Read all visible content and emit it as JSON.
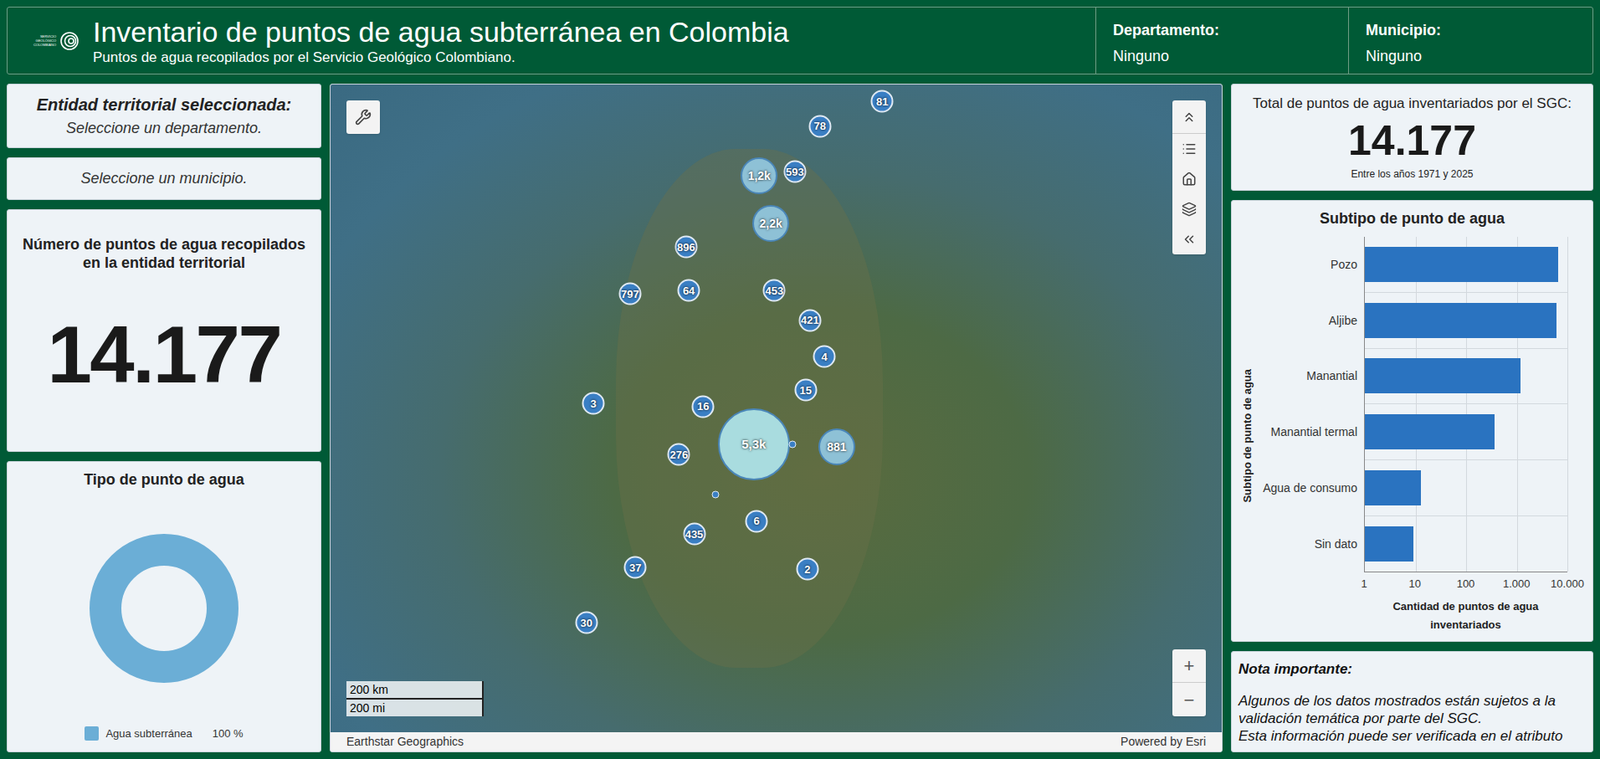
{
  "header": {
    "logo_text": "SERVICIO GEOLÓGICO COLOMBIANO",
    "title": "Inventario de puntos de agua subterránea en Colombia",
    "subtitle": "Puntos de agua recopilados por el Servicio Geológico Colombiano.",
    "filters": [
      {
        "label": "Departamento:",
        "value": "Ninguno"
      },
      {
        "label": "Municipio:",
        "value": "Ninguno"
      }
    ]
  },
  "left": {
    "entity_card": {
      "title": "Entidad territorial seleccionada:",
      "hint": "Seleccione un departamento."
    },
    "municipio_card": {
      "hint": "Seleccione un municipio."
    },
    "count_card": {
      "title": "Número de puntos de agua recopilados en la entidad territorial",
      "value": "14.177"
    },
    "type_card": {
      "title": "Tipo de punto de agua",
      "series": [
        {
          "label": "Agua subterránea",
          "percent_text": "100 %",
          "values": [
            100
          ],
          "color": "#6baed6"
        }
      ]
    }
  },
  "map": {
    "clusters": [
      {
        "label": "81",
        "kind": "small"
      },
      {
        "label": "78",
        "kind": "small"
      },
      {
        "label": "1,2k",
        "kind": "medium"
      },
      {
        "label": "593",
        "kind": "small"
      },
      {
        "label": "2,2k",
        "kind": "medium"
      },
      {
        "label": "896",
        "kind": "small"
      },
      {
        "label": "797",
        "kind": "small"
      },
      {
        "label": "64",
        "kind": "small"
      },
      {
        "label": "453",
        "kind": "small"
      },
      {
        "label": "421",
        "kind": "small"
      },
      {
        "label": "4",
        "kind": "small"
      },
      {
        "label": "15",
        "kind": "small"
      },
      {
        "label": "3",
        "kind": "small"
      },
      {
        "label": "16",
        "kind": "small"
      },
      {
        "label": "276",
        "kind": "small"
      },
      {
        "label": "5,3k",
        "kind": "large"
      },
      {
        "label": "881",
        "kind": "medium"
      },
      {
        "label": "435",
        "kind": "small"
      },
      {
        "label": "6",
        "kind": "small"
      },
      {
        "label": "37",
        "kind": "small"
      },
      {
        "label": "2",
        "kind": "small"
      },
      {
        "label": "30",
        "kind": "small"
      }
    ],
    "zoom_buttons": [
      "+",
      "−"
    ],
    "scale": [
      "200 km",
      "200 mi"
    ],
    "attribution_left": "Earthstar Geographics",
    "attribution_right": "Powered by Esri"
  },
  "right": {
    "total_card": {
      "title": "Total de puntos de agua inventariados por el SGC:",
      "value": "14.177",
      "subtitle": "Entre los años 1971 y 2025"
    },
    "subtype_chart": {
      "title": "Subtipo de punto de agua",
      "y_axis_title": "Subtipo de punto de agua",
      "x_axis_title": "Cantidad de puntos de agua inventariados",
      "ticks": [
        "1",
        "10",
        "100",
        "1.000",
        "10.000"
      ],
      "categories": [
        "Pozo",
        "Aljibe",
        "Manantial",
        "Manantial termal",
        "Agua de consumo",
        "Sin dato"
      ],
      "values": [
        6510,
        6100,
        1180,
        365,
        13,
        9
      ]
    },
    "note": {
      "title": "Nota importante:",
      "lines": [
        "Algunos de los datos mostrados están sujetos a la validación temática por parte del SGC.",
        "Esta información puede ser verificada en el atributo"
      ]
    }
  }
}
